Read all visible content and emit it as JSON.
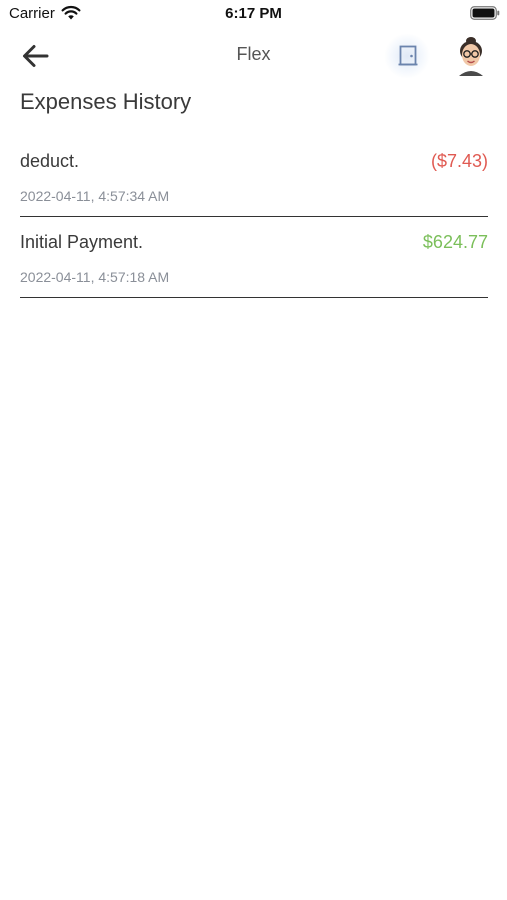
{
  "status_bar": {
    "carrier": "Carrier",
    "time": "6:17 PM"
  },
  "nav": {
    "title": "Flex",
    "back_icon": "arrow-left-icon",
    "exit_icon": "door-icon",
    "avatar": "user-avatar"
  },
  "page": {
    "title": "Expenses History"
  },
  "expenses": [
    {
      "description": "deduct.",
      "amount": "($7.43)",
      "date": "2022-04-11, 4:57:34 AM",
      "amount_color": "#e05a52"
    },
    {
      "description": "Initial Payment.",
      "amount": "$624.77",
      "date": "2022-04-11, 4:57:18 AM",
      "amount_color": "#7bbf5a"
    }
  ],
  "colors": {
    "negative": "#e05a52",
    "positive": "#7bbf5a",
    "exit_accent": "#6b84ad"
  }
}
